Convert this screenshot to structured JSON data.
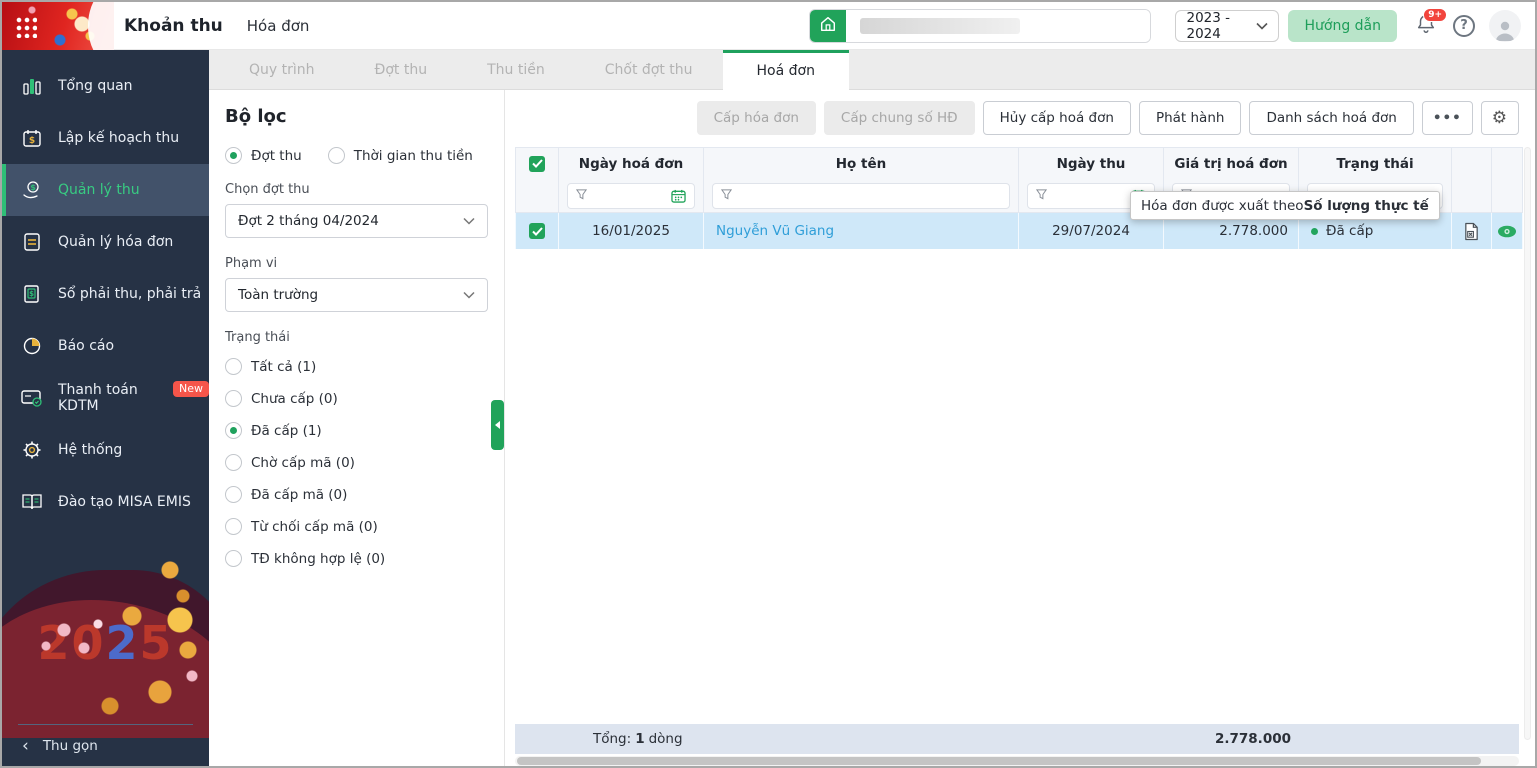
{
  "topbar": {
    "app_title": "Khoản thu",
    "breadcrumb": "Hóa đơn",
    "school_year": "2023 - 2024",
    "guide_label": "Hướng dẫn",
    "bell_badge": "9+",
    "help_glyph": "?"
  },
  "sidebar": {
    "items": [
      {
        "label": "Tổng quan"
      },
      {
        "label": "Lập kế hoạch thu"
      },
      {
        "label": "Quản lý thu"
      },
      {
        "label": "Quản lý hóa đơn"
      },
      {
        "label": "Sổ phải thu, phải trả"
      },
      {
        "label": "Báo cáo"
      },
      {
        "label": "Thanh toán KDTM",
        "badge": "New"
      },
      {
        "label": "Hệ thống"
      },
      {
        "label": "Đào tạo MISA EMIS"
      }
    ],
    "decoration_year_digits": [
      "2",
      "0",
      "2",
      "5"
    ],
    "collapse_label": "Thu gọn"
  },
  "tabs": {
    "items": [
      {
        "label": "Quy trình",
        "active": false
      },
      {
        "label": "Đợt thu",
        "active": false
      },
      {
        "label": "Thu tiền",
        "active": false
      },
      {
        "label": "Chốt đợt thu",
        "active": false
      },
      {
        "label": "Hoá đơn",
        "active": true
      }
    ]
  },
  "filter_panel": {
    "title": "Bộ lọc",
    "mode_options": [
      {
        "label": "Đợt thu",
        "selected": true
      },
      {
        "label": "Thời gian thu tiền",
        "selected": false
      }
    ],
    "batch_label": "Chọn đợt thu",
    "batch_value": "Đợt 2 tháng 04/2024",
    "scope_label": "Phạm vi",
    "scope_value": "Toàn trường",
    "status_label": "Trạng thái",
    "status_options": [
      {
        "label": "Tất cả (1)",
        "selected": false
      },
      {
        "label": "Chưa cấp (0)",
        "selected": false
      },
      {
        "label": "Đã cấp (1)",
        "selected": true
      },
      {
        "label": "Chờ cấp mã (0)",
        "selected": false
      },
      {
        "label": "Đã cấp mã (0)",
        "selected": false
      },
      {
        "label": "Từ chối cấp mã (0)",
        "selected": false
      },
      {
        "label": "TĐ không hợp lệ (0)",
        "selected": false
      }
    ]
  },
  "toolbar": {
    "buttons": [
      {
        "label": "Cấp hóa đơn",
        "disabled": true
      },
      {
        "label": "Cấp chung số HĐ",
        "disabled": true
      },
      {
        "label": "Hủy cấp hoá đơn",
        "disabled": false
      },
      {
        "label": "Phát hành",
        "disabled": false
      },
      {
        "label": "Danh sách hoá đơn",
        "disabled": false
      }
    ],
    "more_label": "•••"
  },
  "table": {
    "columns": [
      "Ngày hoá đơn",
      "Họ tên",
      "Ngày thu",
      "Giá trị hoá đơn",
      "Trạng thái"
    ],
    "rows": [
      {
        "checked": true,
        "invoice_date": "16/01/2025",
        "full_name": "Nguyễn Vũ Giang",
        "collect_date": "29/07/2024",
        "invoice_value": "2.778.000",
        "status": "Đã cấp"
      }
    ]
  },
  "tooltip": {
    "prefix": "Hóa đơn được xuất theo ",
    "bold": "Số lượng thực tế"
  },
  "footer": {
    "total_prefix": "Tổng:",
    "total_rows": "1",
    "total_suffix": "dòng",
    "total_amount": "2.778.000"
  },
  "colors": {
    "accent_green": "#1fa15d",
    "link_blue": "#2f9ed8",
    "row_highlight": "#cfe8f9",
    "sidebar_bg": "#263245",
    "badge_red": "#f5554a",
    "disabled_bg": "#ebebeb"
  }
}
